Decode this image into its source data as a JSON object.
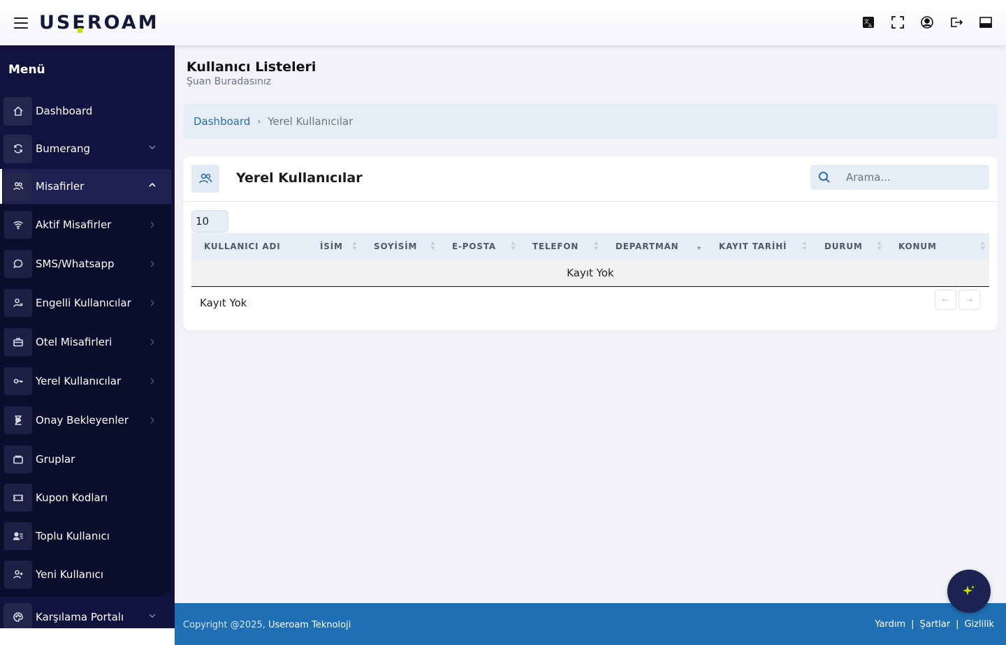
{
  "brand": {
    "logo_text": "USEROAM"
  },
  "topbar": {
    "icons": [
      "translate-icon",
      "fullscreen-icon",
      "user-circle-icon",
      "logout-icon",
      "window-icon"
    ]
  },
  "sidebar": {
    "title": "Menü",
    "items": [
      {
        "label": "Dashboard",
        "icon": "home-icon"
      },
      {
        "label": "Bumerang",
        "icon": "refresh-icon"
      },
      {
        "label": "Misafirler",
        "icon": "users-icon"
      },
      {
        "label": "Karşılama Portalı",
        "icon": "palette-icon"
      }
    ],
    "subitems": [
      {
        "label": "Aktif Misafirler",
        "icon": "wifi-icon"
      },
      {
        "label": "SMS/Whatsapp",
        "icon": "chat-icon"
      },
      {
        "label": "Engelli Kullanıcılar",
        "icon": "user-block-icon"
      },
      {
        "label": "Otel Misafirleri",
        "icon": "briefcase-icon"
      },
      {
        "label": "Yerel Kullanıcılar",
        "icon": "key-icon"
      },
      {
        "label": "Onay Bekleyenler",
        "icon": "hourglass-icon"
      },
      {
        "label": "Gruplar",
        "icon": "folder-icon"
      },
      {
        "label": "Kupon Kodları",
        "icon": "ticket-icon"
      },
      {
        "label": "Toplu Kullanıcı",
        "icon": "user-list-icon"
      },
      {
        "label": "Yeni Kullanıcı",
        "icon": "user-plus-icon"
      }
    ]
  },
  "page": {
    "title": "Kullanıcı Listeleri",
    "subtitle": "Şuan Buradasınız"
  },
  "breadcrumb": {
    "home": "Dashboard",
    "current": "Yerel Kullanıcılar"
  },
  "card": {
    "title": "Yerel Kullanıcılar",
    "search_placeholder": "Arama...",
    "page_size": "10",
    "columns": [
      "KULLANICI ADI",
      "İSİM",
      "SOYİSİM",
      "E-POSTA",
      "TELEFON",
      "DEPARTMAN",
      "KAYIT TARİHİ",
      "DURUM",
      "KONUM"
    ],
    "empty_text": "Kayıt Yok",
    "footer_text": "Kayıt Yok",
    "prev": "←",
    "next": "→"
  },
  "footer": {
    "copyright": "Copyright @2025,",
    "company": "Useroam Teknoloji",
    "links": [
      "Yardım",
      "Şartlar",
      "Gizlilik"
    ],
    "separator": "|"
  },
  "colors": {
    "sidebar_bg": "#12123e",
    "accent": "#2c6ea3",
    "footer_bg": "#1e6fb3",
    "logo_accent": "#c8e000"
  }
}
